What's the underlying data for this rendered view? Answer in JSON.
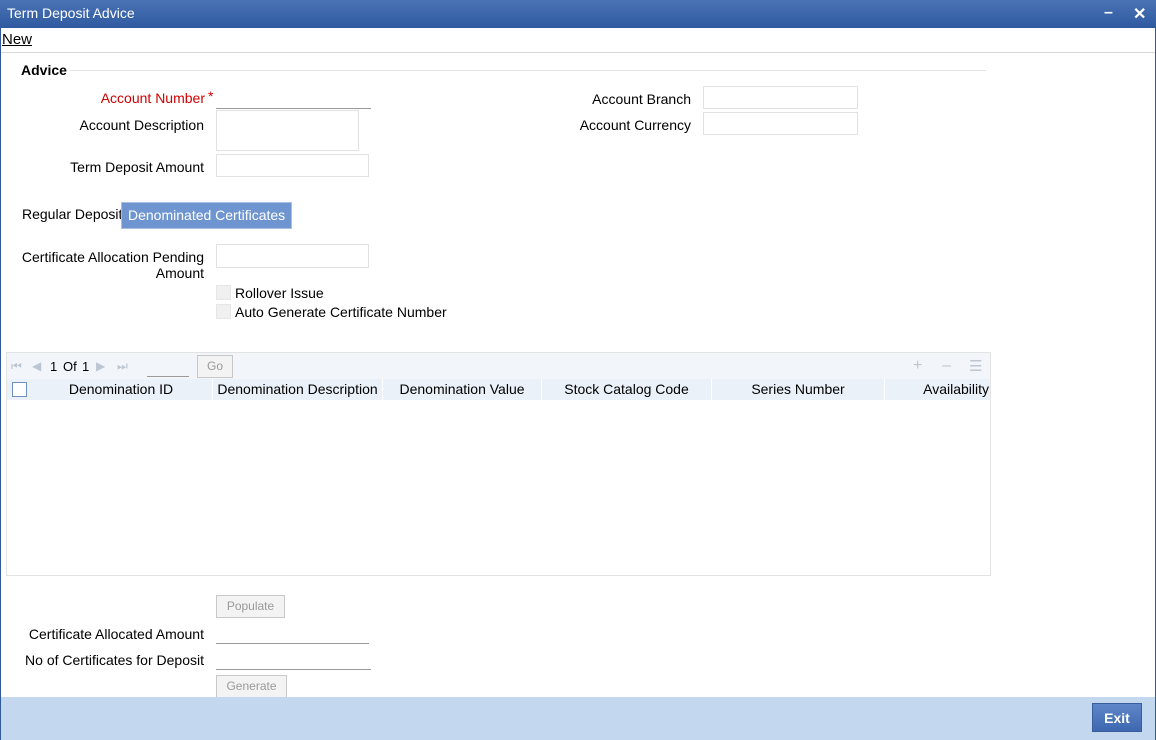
{
  "window": {
    "title": "Term Deposit Advice",
    "minimize_icon": "minimize-icon",
    "close_icon": "close-icon"
  },
  "menu": {
    "new_label": "New"
  },
  "advice": {
    "section_title": "Advice",
    "account_number_label": "Account Number",
    "required_mark": "*",
    "account_number_value": "",
    "account_description_label": "Account Description",
    "account_description_value": "",
    "term_deposit_amount_label": "Term Deposit Amount",
    "term_deposit_amount_value": "",
    "account_branch_label": "Account Branch",
    "account_branch_value": "",
    "account_currency_label": "Account Currency",
    "account_currency_value": ""
  },
  "tabs": [
    {
      "label": "Regular Deposit",
      "active": false
    },
    {
      "label": "Denominated Certificates",
      "active": true
    }
  ],
  "certificates": {
    "pending_label_line1": "Certificate Allocation Pending",
    "pending_label_line2": "Amount",
    "pending_value": "",
    "rollover_issue_label": "Rollover Issue",
    "auto_generate_label": "Auto Generate Certificate Number"
  },
  "grid": {
    "page_current": "1",
    "page_of": "Of",
    "page_total": "1",
    "page_input": "",
    "go_label": "Go",
    "columns": [
      "Denomination ID",
      "Denomination Description",
      "Denomination Value",
      "Stock Catalog Code",
      "Series Number",
      "Availability"
    ],
    "rows": []
  },
  "bottom": {
    "populate_label": "Populate",
    "allocated_amount_label": "Certificate Allocated Amount",
    "allocated_amount_value": "",
    "no_of_certificates_label": "No of Certificates for Deposit",
    "no_of_certificates_value": "",
    "generate_label": "Generate"
  },
  "footer": {
    "exit_label": "Exit"
  },
  "colors": {
    "titlebar": "#2f5aa0",
    "active_tab": "#6e95cf",
    "footer": "#c3d7ee",
    "required": "#d00000"
  }
}
